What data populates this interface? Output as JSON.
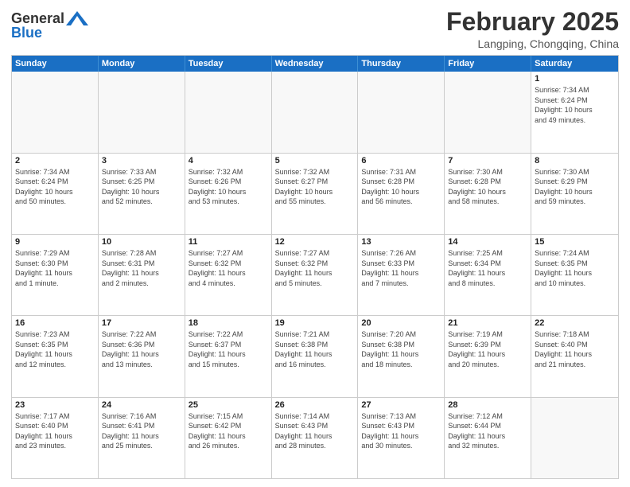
{
  "header": {
    "logo_general": "General",
    "logo_blue": "Blue",
    "month_title": "February 2025",
    "location": "Langping, Chongqing, China"
  },
  "days_of_week": [
    "Sunday",
    "Monday",
    "Tuesday",
    "Wednesday",
    "Thursday",
    "Friday",
    "Saturday"
  ],
  "weeks": [
    [
      {
        "day": "",
        "info": ""
      },
      {
        "day": "",
        "info": ""
      },
      {
        "day": "",
        "info": ""
      },
      {
        "day": "",
        "info": ""
      },
      {
        "day": "",
        "info": ""
      },
      {
        "day": "",
        "info": ""
      },
      {
        "day": "1",
        "info": "Sunrise: 7:34 AM\nSunset: 6:24 PM\nDaylight: 10 hours\nand 49 minutes."
      }
    ],
    [
      {
        "day": "2",
        "info": "Sunrise: 7:34 AM\nSunset: 6:24 PM\nDaylight: 10 hours\nand 50 minutes."
      },
      {
        "day": "3",
        "info": "Sunrise: 7:33 AM\nSunset: 6:25 PM\nDaylight: 10 hours\nand 52 minutes."
      },
      {
        "day": "4",
        "info": "Sunrise: 7:32 AM\nSunset: 6:26 PM\nDaylight: 10 hours\nand 53 minutes."
      },
      {
        "day": "5",
        "info": "Sunrise: 7:32 AM\nSunset: 6:27 PM\nDaylight: 10 hours\nand 55 minutes."
      },
      {
        "day": "6",
        "info": "Sunrise: 7:31 AM\nSunset: 6:28 PM\nDaylight: 10 hours\nand 56 minutes."
      },
      {
        "day": "7",
        "info": "Sunrise: 7:30 AM\nSunset: 6:28 PM\nDaylight: 10 hours\nand 58 minutes."
      },
      {
        "day": "8",
        "info": "Sunrise: 7:30 AM\nSunset: 6:29 PM\nDaylight: 10 hours\nand 59 minutes."
      }
    ],
    [
      {
        "day": "9",
        "info": "Sunrise: 7:29 AM\nSunset: 6:30 PM\nDaylight: 11 hours\nand 1 minute."
      },
      {
        "day": "10",
        "info": "Sunrise: 7:28 AM\nSunset: 6:31 PM\nDaylight: 11 hours\nand 2 minutes."
      },
      {
        "day": "11",
        "info": "Sunrise: 7:27 AM\nSunset: 6:32 PM\nDaylight: 11 hours\nand 4 minutes."
      },
      {
        "day": "12",
        "info": "Sunrise: 7:27 AM\nSunset: 6:32 PM\nDaylight: 11 hours\nand 5 minutes."
      },
      {
        "day": "13",
        "info": "Sunrise: 7:26 AM\nSunset: 6:33 PM\nDaylight: 11 hours\nand 7 minutes."
      },
      {
        "day": "14",
        "info": "Sunrise: 7:25 AM\nSunset: 6:34 PM\nDaylight: 11 hours\nand 8 minutes."
      },
      {
        "day": "15",
        "info": "Sunrise: 7:24 AM\nSunset: 6:35 PM\nDaylight: 11 hours\nand 10 minutes."
      }
    ],
    [
      {
        "day": "16",
        "info": "Sunrise: 7:23 AM\nSunset: 6:35 PM\nDaylight: 11 hours\nand 12 minutes."
      },
      {
        "day": "17",
        "info": "Sunrise: 7:22 AM\nSunset: 6:36 PM\nDaylight: 11 hours\nand 13 minutes."
      },
      {
        "day": "18",
        "info": "Sunrise: 7:22 AM\nSunset: 6:37 PM\nDaylight: 11 hours\nand 15 minutes."
      },
      {
        "day": "19",
        "info": "Sunrise: 7:21 AM\nSunset: 6:38 PM\nDaylight: 11 hours\nand 16 minutes."
      },
      {
        "day": "20",
        "info": "Sunrise: 7:20 AM\nSunset: 6:38 PM\nDaylight: 11 hours\nand 18 minutes."
      },
      {
        "day": "21",
        "info": "Sunrise: 7:19 AM\nSunset: 6:39 PM\nDaylight: 11 hours\nand 20 minutes."
      },
      {
        "day": "22",
        "info": "Sunrise: 7:18 AM\nSunset: 6:40 PM\nDaylight: 11 hours\nand 21 minutes."
      }
    ],
    [
      {
        "day": "23",
        "info": "Sunrise: 7:17 AM\nSunset: 6:40 PM\nDaylight: 11 hours\nand 23 minutes."
      },
      {
        "day": "24",
        "info": "Sunrise: 7:16 AM\nSunset: 6:41 PM\nDaylight: 11 hours\nand 25 minutes."
      },
      {
        "day": "25",
        "info": "Sunrise: 7:15 AM\nSunset: 6:42 PM\nDaylight: 11 hours\nand 26 minutes."
      },
      {
        "day": "26",
        "info": "Sunrise: 7:14 AM\nSunset: 6:43 PM\nDaylight: 11 hours\nand 28 minutes."
      },
      {
        "day": "27",
        "info": "Sunrise: 7:13 AM\nSunset: 6:43 PM\nDaylight: 11 hours\nand 30 minutes."
      },
      {
        "day": "28",
        "info": "Sunrise: 7:12 AM\nSunset: 6:44 PM\nDaylight: 11 hours\nand 32 minutes."
      },
      {
        "day": "",
        "info": ""
      }
    ]
  ]
}
